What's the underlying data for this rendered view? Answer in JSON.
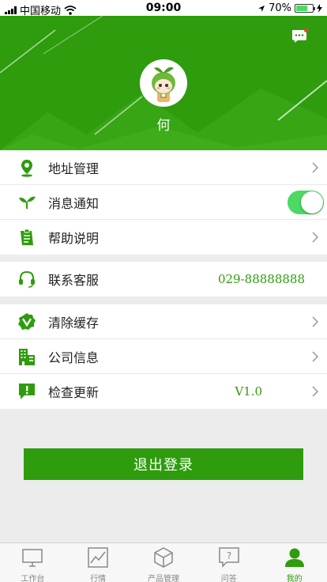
{
  "status_bar": {
    "carrier": "中国移动",
    "time": "09:00",
    "battery": "70%",
    "battery_level": 0.7
  },
  "header": {
    "username": "何",
    "avatar_icon": "sprout-mascot-avatar",
    "message_icon": "message-bubble-icon",
    "background_color": "#2e9c0d"
  },
  "menu": {
    "address": {
      "label": "地址管理",
      "icon": "location-pin-icon"
    },
    "notification": {
      "label": "消息通知",
      "icon": "sprout-icon",
      "enabled": true
    },
    "help": {
      "label": "帮助说明",
      "icon": "clipboard-icon"
    },
    "service": {
      "label": "联系客服",
      "value": "029-88888888",
      "icon": "headset-icon"
    },
    "cache": {
      "label": "清除缓存",
      "icon": "check-badge-icon"
    },
    "company": {
      "label": "公司信息",
      "icon": "building-icon"
    },
    "update": {
      "label": "检查更新",
      "value": "V1.0",
      "icon": "alert-message-icon"
    }
  },
  "logout_label": "退出登录",
  "tabs": [
    {
      "label": "工作台",
      "icon": "monitor-icon",
      "active": false
    },
    {
      "label": "行情",
      "icon": "trend-chart-icon",
      "active": false
    },
    {
      "label": "产品管理",
      "icon": "box-icon",
      "active": false
    },
    {
      "label": "问答",
      "icon": "question-bubble-icon",
      "active": false
    },
    {
      "label": "我的",
      "icon": "user-icon",
      "active": true
    }
  ],
  "colors": {
    "accent": "#2e9c0d",
    "toggle_on": "#4cd964"
  }
}
